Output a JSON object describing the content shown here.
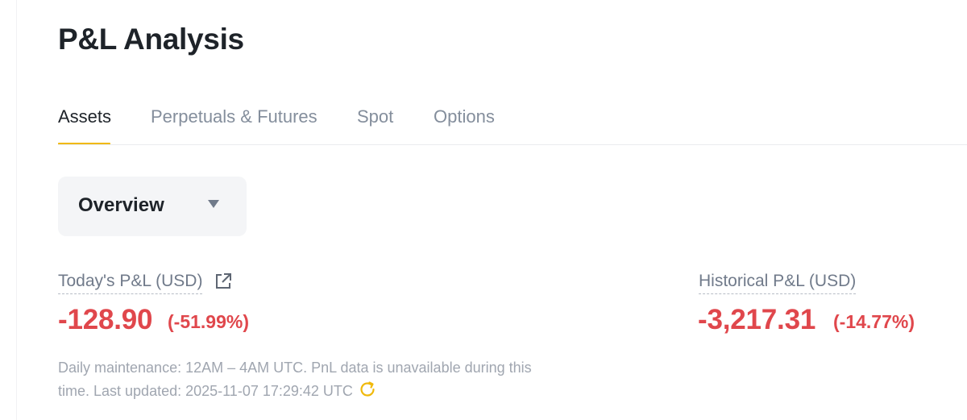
{
  "page": {
    "title": "P&L Analysis"
  },
  "tabs": [
    {
      "label": "Assets",
      "active": true
    },
    {
      "label": "Perpetuals & Futures",
      "active": false
    },
    {
      "label": "Spot",
      "active": false
    },
    {
      "label": "Options",
      "active": false
    }
  ],
  "view_selector": {
    "selected": "Overview",
    "icon": "caret-down-icon"
  },
  "today_pnl": {
    "label": "Today's P&L (USD)",
    "value": "-128.90",
    "percent": "(-51.99%)",
    "icon": "external-link-icon"
  },
  "historical_pnl": {
    "label": "Historical P&L (USD)",
    "value": "-3,217.31",
    "percent": "(-14.77%)"
  },
  "maintenance_note": {
    "line1": "Daily maintenance: 12AM – 4AM UTC. PnL data is unavailable during this",
    "line2": "time. Last updated: 2025-11-07 17:29:42 UTC",
    "icon": "refresh-icon"
  },
  "colors": {
    "accent": "#f0b90b",
    "negative": "#e0474c",
    "text_primary": "#1e2329",
    "text_secondary": "#848e9c"
  }
}
